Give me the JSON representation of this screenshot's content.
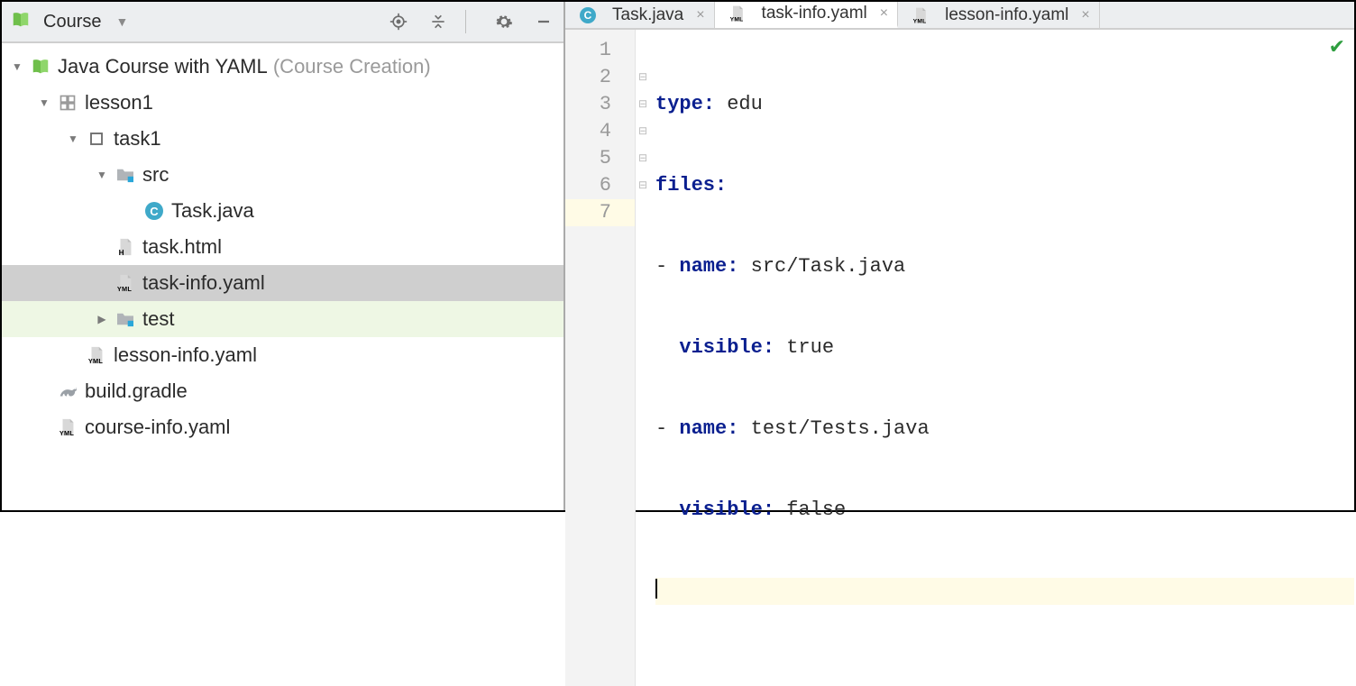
{
  "sidebar": {
    "title": "Course",
    "tree": {
      "root": {
        "label": "Java Course with YAML",
        "suffix": "(Course Creation)"
      },
      "lesson": "lesson1",
      "task": "task1",
      "src": "src",
      "task_java": "Task.java",
      "task_html": "task.html",
      "task_info": "task-info.yaml",
      "test": "test",
      "lesson_info": "lesson-info.yaml",
      "build_gradle": "build.gradle",
      "course_info": "course-info.yaml"
    }
  },
  "tabs": [
    {
      "label": "Task.java",
      "icon": "class"
    },
    {
      "label": "task-info.yaml",
      "icon": "yml",
      "active": true
    },
    {
      "label": "lesson-info.yaml",
      "icon": "yml"
    }
  ],
  "gutter": [
    "1",
    "2",
    "3",
    "4",
    "5",
    "6",
    "7"
  ],
  "code": {
    "l1": {
      "k": "type:",
      "v": " edu"
    },
    "l2": {
      "k": "files:"
    },
    "l3": {
      "p": "- ",
      "k": "name:",
      "v": " src/Task.java"
    },
    "l4": {
      "p": "  ",
      "k": "visible:",
      "v": " true"
    },
    "l5": {
      "p": "- ",
      "k": "name:",
      "v": " test/Tests.java"
    },
    "l6": {
      "p": "  ",
      "k": "visible:",
      "v": " false"
    }
  }
}
